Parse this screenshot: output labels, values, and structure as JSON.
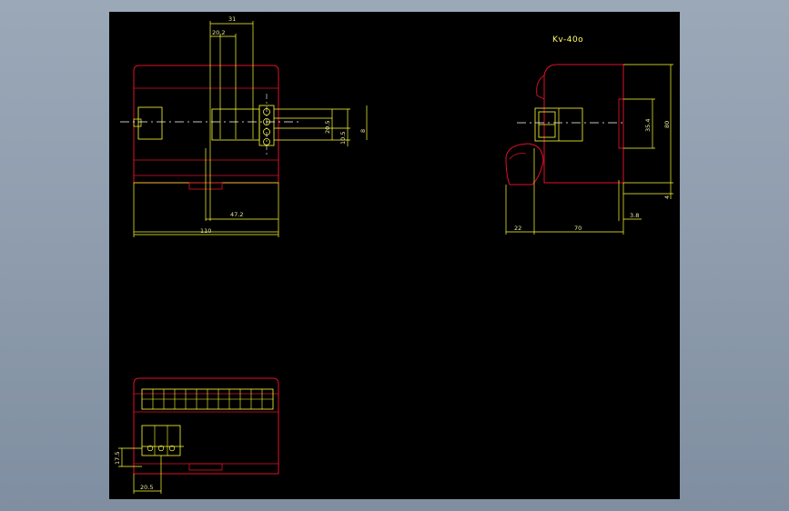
{
  "drawing": {
    "title": "Kv-40o",
    "colors": {
      "background": "#000000",
      "outline": "#e0102a",
      "dimension": "#ffff33",
      "centerline": "#ffffff",
      "frame": "#8e9cad"
    }
  },
  "front_view": {
    "dims": {
      "top_width": "31",
      "inner_width": "20.2",
      "bottom_width": "47.2",
      "overall_width": "110",
      "v1": "20.5",
      "v2": "10.5",
      "v3": "8"
    }
  },
  "side_view": {
    "dims": {
      "height_inner": "35.4",
      "height_total": "80",
      "bottom_left": "22",
      "bottom_mid": "70",
      "bottom_right": "3.8",
      "right_small": "4"
    }
  },
  "bottom_view": {
    "dims": {
      "vertical": "17.5",
      "horizontal": "20.5"
    }
  }
}
